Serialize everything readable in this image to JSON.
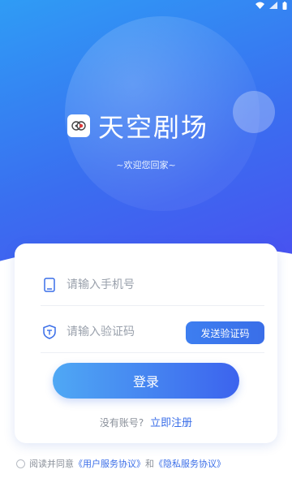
{
  "app": {
    "name": "天空剧场",
    "welcome": "~欢迎您回家~"
  },
  "form": {
    "phone_placeholder": "请输入手机号",
    "code_placeholder": "请输入验证码",
    "send_code_label": "发送验证码",
    "login_label": "登录"
  },
  "register": {
    "question": "没有账号?",
    "link": "立即注册"
  },
  "agreement": {
    "prefix": "阅读并同意",
    "user_agreement": "《用户服务协议》",
    "and": "和",
    "privacy_agreement": "《隐私服务协议》"
  },
  "colors": {
    "accent": "#3a6ee8",
    "hero_start": "#2f9cf5",
    "hero_end": "#4a4ff0"
  },
  "icons": {
    "wifi": "wifi-icon",
    "signal": "signal-icon",
    "battery": "battery-icon",
    "phone": "phone-icon",
    "shield": "shield-icon"
  }
}
